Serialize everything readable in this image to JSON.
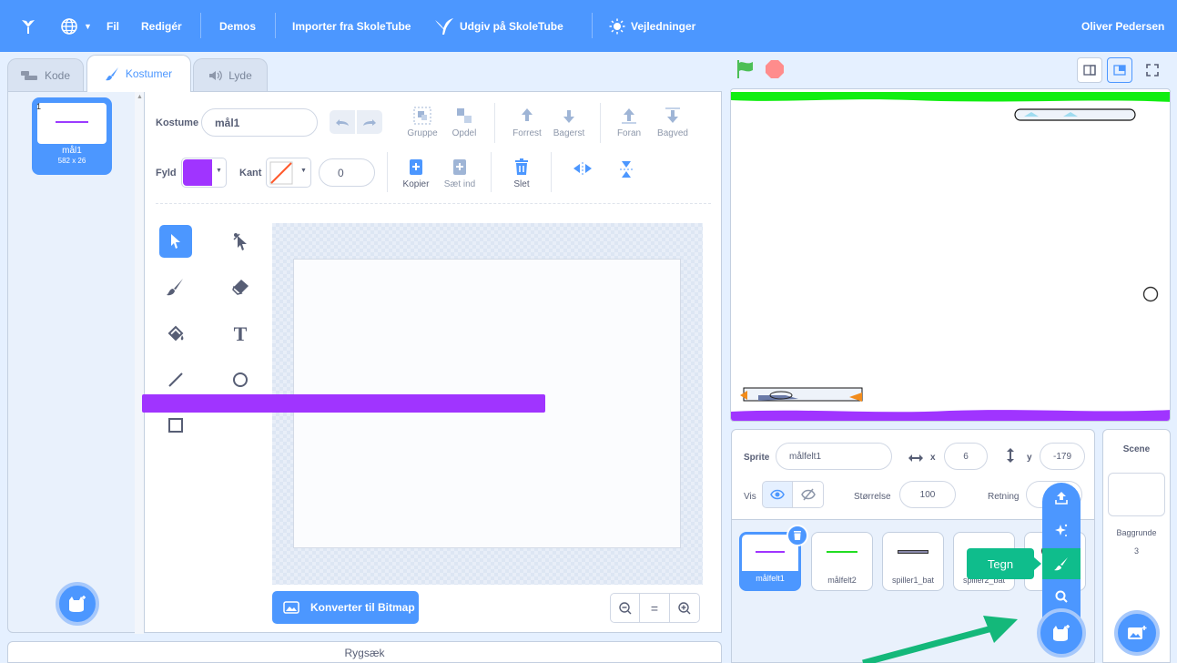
{
  "menu": {
    "file": "Fil",
    "edit": "Redigér",
    "demos": "Demos",
    "import": "Importer fra SkoleTube",
    "publish": "Udgiv på SkoleTube",
    "guides": "Vejledninger",
    "user": "Oliver Pedersen"
  },
  "tabs": {
    "code": "Kode",
    "costumes": "Kostumer",
    "sounds": "Lyde"
  },
  "costume_list": [
    {
      "index": "1",
      "name": "mål1",
      "size": "582 x 26"
    }
  ],
  "editor": {
    "costume_label": "Kostume",
    "costume_name": "mål1",
    "group": "Gruppe",
    "ungroup": "Opdel",
    "forward": "Forrest",
    "backward": "Bagerst",
    "front": "Foran",
    "back": "Bagved",
    "fill_label": "Fyld",
    "outline_label": "Kant",
    "outline_width": "0",
    "copy": "Kopier",
    "paste": "Sæt ind",
    "delete": "Slet",
    "convert_bitmap": "Konverter til Bitmap",
    "colors": {
      "fill": "#a034ff",
      "stroke_preview": "#a034ff"
    }
  },
  "backpack": "Rygsæk",
  "sprite_info": {
    "sprite_label": "Sprite",
    "sprite_name": "målfelt1",
    "x_label": "x",
    "x_value": "6",
    "y_label": "y",
    "y_value": "-179",
    "show_label": "Vis",
    "size_label": "Størrelse",
    "size_value": "100",
    "direction_label": "Retning"
  },
  "sprites": [
    {
      "name": "målfelt1",
      "color": "#a034ff"
    },
    {
      "name": "målfelt2",
      "color": "#22dd22"
    },
    {
      "name": "spiller1_bat",
      "color": "#8888aa"
    },
    {
      "name": "spiller2_bat",
      "color": "#8888aa"
    }
  ],
  "scene": {
    "title": "Scene",
    "backdrops_label": "Baggrunde",
    "backdrops_count": "3"
  },
  "fab_tooltip": "Tegn"
}
